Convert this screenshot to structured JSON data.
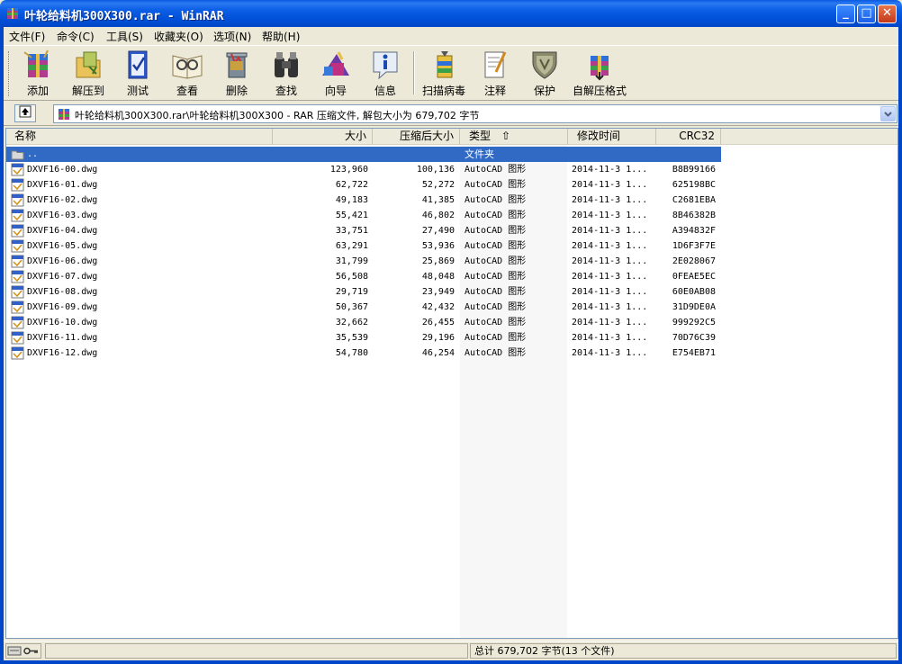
{
  "window": {
    "title": "叶轮给料机300X300.rar - WinRAR"
  },
  "menu": [
    {
      "label": "文件(F)"
    },
    {
      "label": "命令(C)"
    },
    {
      "label": "工具(S)"
    },
    {
      "label": "收藏夹(O)"
    },
    {
      "label": "选项(N)"
    },
    {
      "label": "帮助(H)"
    }
  ],
  "toolbar": [
    {
      "label": "添加",
      "icon": "add-icon"
    },
    {
      "label": "解压到",
      "icon": "extract-to-icon"
    },
    {
      "label": "测试",
      "icon": "test-icon"
    },
    {
      "label": "查看",
      "icon": "view-icon"
    },
    {
      "label": "删除",
      "icon": "delete-icon"
    },
    {
      "label": "查找",
      "icon": "find-icon"
    },
    {
      "label": "向导",
      "icon": "wizard-icon"
    },
    {
      "label": "信息",
      "icon": "info-icon"
    },
    {
      "label": "扫描病毒",
      "icon": "virus-scan-icon"
    },
    {
      "label": "注释",
      "icon": "comment-icon"
    },
    {
      "label": "保护",
      "icon": "protect-icon"
    },
    {
      "label": "自解压格式",
      "icon": "sfx-icon"
    }
  ],
  "address": {
    "text": "叶轮给料机300X300.rar\\叶轮给料机300X300 - RAR 压缩文件, 解包大小为 679,702 字节"
  },
  "columns": {
    "name": "名称",
    "size": "大小",
    "packed": "压缩后大小",
    "type": "类型",
    "modified": "修改时间",
    "crc": "CRC32"
  },
  "parent_row": {
    "name": "..",
    "type": "文件夹"
  },
  "files": [
    {
      "name": "DXVF16-00.dwg",
      "size": "123,960",
      "packed": "100,136",
      "type": "AutoCAD 图形",
      "modified": "2014-11-3 1...",
      "crc": "B8B99166"
    },
    {
      "name": "DXVF16-01.dwg",
      "size": "62,722",
      "packed": "52,272",
      "type": "AutoCAD 图形",
      "modified": "2014-11-3 1...",
      "crc": "625198BC"
    },
    {
      "name": "DXVF16-02.dwg",
      "size": "49,183",
      "packed": "41,385",
      "type": "AutoCAD 图形",
      "modified": "2014-11-3 1...",
      "crc": "C2681EBA"
    },
    {
      "name": "DXVF16-03.dwg",
      "size": "55,421",
      "packed": "46,802",
      "type": "AutoCAD 图形",
      "modified": "2014-11-3 1...",
      "crc": "8B46382B"
    },
    {
      "name": "DXVF16-04.dwg",
      "size": "33,751",
      "packed": "27,490",
      "type": "AutoCAD 图形",
      "modified": "2014-11-3 1...",
      "crc": "A394832F"
    },
    {
      "name": "DXVF16-05.dwg",
      "size": "63,291",
      "packed": "53,936",
      "type": "AutoCAD 图形",
      "modified": "2014-11-3 1...",
      "crc": "1D6F3F7E"
    },
    {
      "name": "DXVF16-06.dwg",
      "size": "31,799",
      "packed": "25,869",
      "type": "AutoCAD 图形",
      "modified": "2014-11-3 1...",
      "crc": "2E028067"
    },
    {
      "name": "DXVF16-07.dwg",
      "size": "56,508",
      "packed": "48,048",
      "type": "AutoCAD 图形",
      "modified": "2014-11-3 1...",
      "crc": "0FEAE5EC"
    },
    {
      "name": "DXVF16-08.dwg",
      "size": "29,719",
      "packed": "23,949",
      "type": "AutoCAD 图形",
      "modified": "2014-11-3 1...",
      "crc": "60E0AB08"
    },
    {
      "name": "DXVF16-09.dwg",
      "size": "50,367",
      "packed": "42,432",
      "type": "AutoCAD 图形",
      "modified": "2014-11-3 1...",
      "crc": "31D9DE0A"
    },
    {
      "name": "DXVF16-10.dwg",
      "size": "32,662",
      "packed": "26,455",
      "type": "AutoCAD 图形",
      "modified": "2014-11-3 1...",
      "crc": "999292C5"
    },
    {
      "name": "DXVF16-11.dwg",
      "size": "35,539",
      "packed": "29,196",
      "type": "AutoCAD 图形",
      "modified": "2014-11-3 1...",
      "crc": "70D76C39"
    },
    {
      "name": "DXVF16-12.dwg",
      "size": "54,780",
      "packed": "46,254",
      "type": "AutoCAD 图形",
      "modified": "2014-11-3 1...",
      "crc": "E754EB71"
    }
  ],
  "status": {
    "summary": "总计 679,702 字节(13 个文件)"
  },
  "colors": {
    "titlebar": "#0051d8",
    "selection": "#316ac5",
    "chrome": "#ece9d8"
  }
}
